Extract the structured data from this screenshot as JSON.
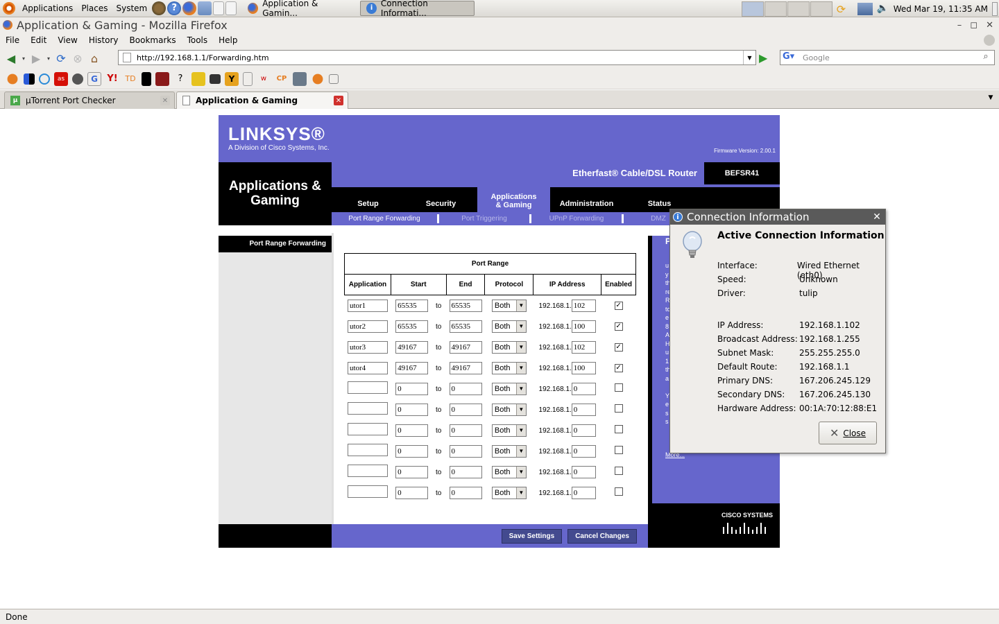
{
  "panel": {
    "menus": [
      "Applications",
      "Places",
      "System"
    ],
    "tasks": [
      {
        "label": "Application & Gamin..."
      },
      {
        "label": "Connection Informati..."
      }
    ],
    "clock": "Wed Mar 19, 11:35 AM"
  },
  "window": {
    "title": "Application & Gaming - Mozilla Firefox",
    "menus": [
      "File",
      "Edit",
      "View",
      "History",
      "Bookmarks",
      "Tools",
      "Help"
    ],
    "url": "http://192.168.1.1/Forwarding.htm",
    "search_placeholder": "Google",
    "tabs": [
      {
        "label": "µTorrent Port Checker"
      },
      {
        "label": "Application & Gaming"
      }
    ],
    "status": "Done"
  },
  "router": {
    "brand": "LINKSYS®",
    "division": "A Division of Cisco Systems, Inc.",
    "firmware": "Firmware Version: 2.00.1",
    "product": "Etherfast® Cable/DSL Router",
    "model": "BEFSR41",
    "section_title": "Applications & Gaming",
    "tabs": [
      "Setup",
      "Security",
      "Applications & Gaming",
      "Administration",
      "Status"
    ],
    "subtabs": [
      "Port Range Forwarding",
      "Port Triggering",
      "UPnP Forwarding",
      "DMZ"
    ],
    "left_title": "Port Range Forwarding",
    "table_title": "Port Range",
    "columns": [
      "Application",
      "Start",
      "End",
      "Protocol",
      "IP Address",
      "Enabled"
    ],
    "ip_prefix": "192.168.1.",
    "to_label": "to",
    "rows": [
      {
        "app": "utor1",
        "start": "65535",
        "end": "65535",
        "protocol": "Both",
        "ip": "102",
        "enabled": true
      },
      {
        "app": "utor2",
        "start": "65535",
        "end": "65535",
        "protocol": "Both",
        "ip": "100",
        "enabled": true
      },
      {
        "app": "utor3",
        "start": "49167",
        "end": "49167",
        "protocol": "Both",
        "ip": "102",
        "enabled": true
      },
      {
        "app": "utor4",
        "start": "49167",
        "end": "49167",
        "protocol": "Both",
        "ip": "100",
        "enabled": true
      },
      {
        "app": "",
        "start": "0",
        "end": "0",
        "protocol": "Both",
        "ip": "0",
        "enabled": false
      },
      {
        "app": "",
        "start": "0",
        "end": "0",
        "protocol": "Both",
        "ip": "0",
        "enabled": false
      },
      {
        "app": "",
        "start": "0",
        "end": "0",
        "protocol": "Both",
        "ip": "0",
        "enabled": false
      },
      {
        "app": "",
        "start": "0",
        "end": "0",
        "protocol": "Both",
        "ip": "0",
        "enabled": false
      },
      {
        "app": "",
        "start": "0",
        "end": "0",
        "protocol": "Both",
        "ip": "0",
        "enabled": false
      },
      {
        "app": "",
        "start": "0",
        "end": "0",
        "protocol": "Both",
        "ip": "0",
        "enabled": false
      }
    ],
    "help_more": "More...",
    "save_label": "Save Settings",
    "cancel_label": "Cancel Changes",
    "cisco": "CISCO SYSTEMS"
  },
  "dialog": {
    "title": "Connection Information",
    "heading": "Active Connection Information",
    "fields1": [
      {
        "label": "Interface:",
        "value": "Wired Ethernet (eth0)"
      },
      {
        "label": "Speed:",
        "value": "Unknown"
      },
      {
        "label": "Driver:",
        "value": "tulip"
      }
    ],
    "fields2": [
      {
        "label": "IP Address:",
        "value": "192.168.1.102"
      },
      {
        "label": "Broadcast Address:",
        "value": "192.168.1.255"
      },
      {
        "label": "Subnet Mask:",
        "value": "255.255.255.0"
      },
      {
        "label": "Default Route:",
        "value": "192.168.1.1"
      },
      {
        "label": "Primary DNS:",
        "value": "167.206.245.129"
      },
      {
        "label": "Secondary DNS:",
        "value": "167.206.245.130"
      },
      {
        "label": "Hardware Address:",
        "value": "00:1A:70:12:88:E1"
      }
    ],
    "close_label": "Close"
  },
  "colors": {
    "linksys_purple": "#6666cc",
    "panel": "#dcdad5"
  }
}
